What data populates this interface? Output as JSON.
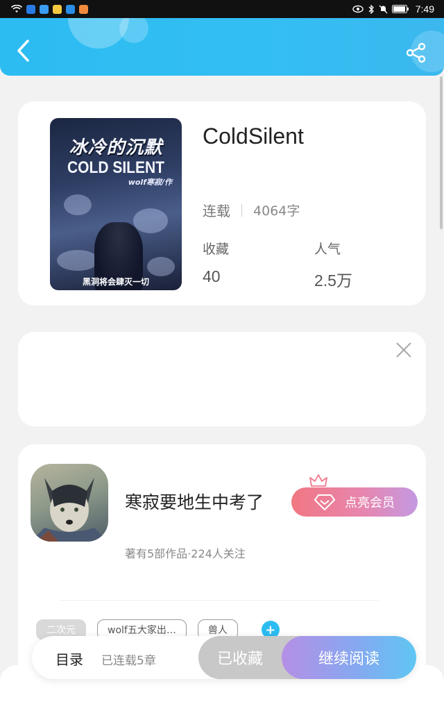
{
  "status_bar": {
    "time": "7:49",
    "left_icons": [
      "wifi-icon",
      "location-icon",
      "search-icon",
      "wechat-icon",
      "qq-icon",
      "chat-icon"
    ],
    "right_icons": [
      "eye-icon",
      "bluetooth-icon",
      "mute-icon",
      "battery-icon"
    ]
  },
  "header": {
    "back_icon": "chevron-left-icon",
    "share_icon": "share-icon",
    "color": "#2cbcf2"
  },
  "book": {
    "cover": {
      "title_cn": "冰冷的沉默",
      "title_en": "COLD SILENT",
      "author": "wolf寒寂/作",
      "tagline": "黑洞将会肆灭一切"
    },
    "title": "ColdSilent",
    "status": "连载",
    "words": "4064字",
    "favorites_label": "收藏",
    "favorites_value": "40",
    "popularity_label": "人气",
    "popularity_value": "2.5万"
  },
  "ad": {
    "close_icon": "close-icon"
  },
  "author": {
    "name": "寒寂要地生中考了",
    "vip_button": "点亮会员",
    "meta": "著有5部作品·224人关注",
    "tags": [
      "二次元",
      "wolf五大家出…",
      "兽人"
    ],
    "add_tag": "+"
  },
  "bottom_bar": {
    "toc_label": "目录",
    "toc_sub": "已连载5章",
    "collected": "已收藏",
    "read": "继续阅读"
  }
}
